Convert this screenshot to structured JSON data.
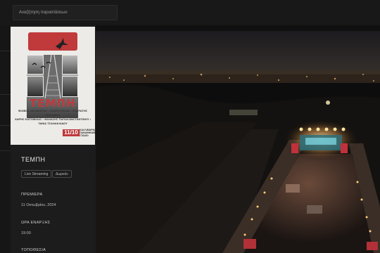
{
  "search": {
    "placeholder": "Αναζήτηση παραστάσεων"
  },
  "poster": {
    "title": "ΤΕΜΠΗ",
    "credits_line1": "ΦΟΙΒΟΣ ΔΕΛΙΒΟΡΙΑΣ • ΚΟΨΟΓΙΟΚΛΙΑ • ΣΩΚΡΑΤΗΣ ΜΑΛΑΜΑΣ",
    "credits_line2": "ΧΑΡΗΣ ΚΑΤΣΙΜΙΧΑΣ • ΘΑΝΑΣΗΣ ΠΑΠΑΚΩΝΣΤΑΝΤΙΝΟΥ • ΤΑΝΙΑ ΤΣΑΝΑΚΛΙΔΟΥ",
    "date": "11/10",
    "venue": "ΠΑΝΑΘΗΝΑΪΚΟ ΣΤΑΔΙΟ",
    "venue_sub": "ΚΑΛΛΙΜΑΡΜΑΡΟ"
  },
  "event": {
    "title": "ΤΕΜΠΗ",
    "tags": [
      "Live Streaming",
      "Δωρεάν"
    ],
    "premiere_label": "ΠΡΕΜΙΕΡΑ",
    "premiere_value": "11 Οκτωβρίου, 2024",
    "start_label": "ΩΡΑ ΕΝΑΡΞΗΣ",
    "start_value": "19:00",
    "venue_label": "ΤΟΠΟΘΕΣΙΑ"
  },
  "colors": {
    "accent": "#c0393b",
    "background": "#141414"
  },
  "video": {
    "description_icon": "stadium-aerial-video"
  }
}
